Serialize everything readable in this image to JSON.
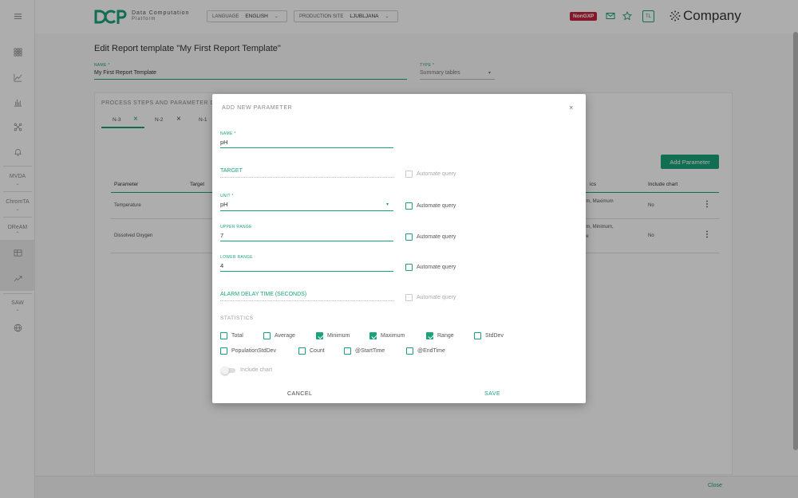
{
  "sidebar": {
    "sections": [
      "MVDA",
      "ChromTA",
      "DReAM",
      "SAW"
    ]
  },
  "header": {
    "logo_letters": "DCP",
    "logo_line1": "Data Computation",
    "logo_line2": "Platform",
    "language_label": "LANGUAGE",
    "language_value": "ENGLISH",
    "site_label": "PRODUCTION SITE",
    "site_value": "LJUBLJANA",
    "env_badge": "NonGXP",
    "user_initials": "TL",
    "company_name": "Company"
  },
  "page": {
    "title": "Edit Report template \"My First Report Template\"",
    "name_label": "NAME *",
    "name_value": "My First Report Template",
    "type_label": "TYPE *",
    "type_value": "Summary tables"
  },
  "card": {
    "title": "PROCESS STEPS AND PARAMETER DE",
    "tabs": [
      "N-3",
      "N-2",
      "N-1"
    ],
    "add_param_label": "Add Parameter",
    "columns": [
      "Parameter",
      "Target",
      "ics",
      "Include chart"
    ],
    "rows": [
      {
        "parameter": "Temperature",
        "stats": "um, Maximum",
        "include_chart": "No"
      },
      {
        "parameter": "Dissolved Oxygen",
        "stats": "um, Minimum,",
        "stats2": "ge",
        "include_chart": "No"
      }
    ]
  },
  "footer": {
    "close_label": "Close"
  },
  "dialog": {
    "title": "ADD NEW PARAMETER",
    "close_glyph": "×",
    "name_label": "NAME *",
    "name_value": "pH",
    "target_placeholder": "TARGET",
    "unit_label": "UNIT *",
    "unit_value": "pH",
    "upper_label": "UPPER RANGE",
    "upper_value": "7",
    "lower_label": "LOWER RANGE",
    "lower_value": "4",
    "alarm_placeholder": "ALARM DELAY TIME (SECONDS)",
    "automate_label": "Automate query",
    "statistics_title": "STATISTICS",
    "stats": [
      {
        "label": "Total",
        "checked": false
      },
      {
        "label": "Average",
        "checked": false
      },
      {
        "label": "Minimum",
        "checked": true
      },
      {
        "label": "Maximum",
        "checked": true
      },
      {
        "label": "Range",
        "checked": true
      },
      {
        "label": "StdDev",
        "checked": false
      },
      {
        "label": "PopulationStdDev",
        "checked": false
      },
      {
        "label": "Count",
        "checked": false
      },
      {
        "label": "@StartTime",
        "checked": false
      },
      {
        "label": "@EndTime",
        "checked": false
      }
    ],
    "include_chart_label": "Include chart",
    "cancel_label": "CANCEL",
    "save_label": "SAVE"
  },
  "colors": {
    "accent": "#1aa37a",
    "badge": "#c6263d"
  }
}
